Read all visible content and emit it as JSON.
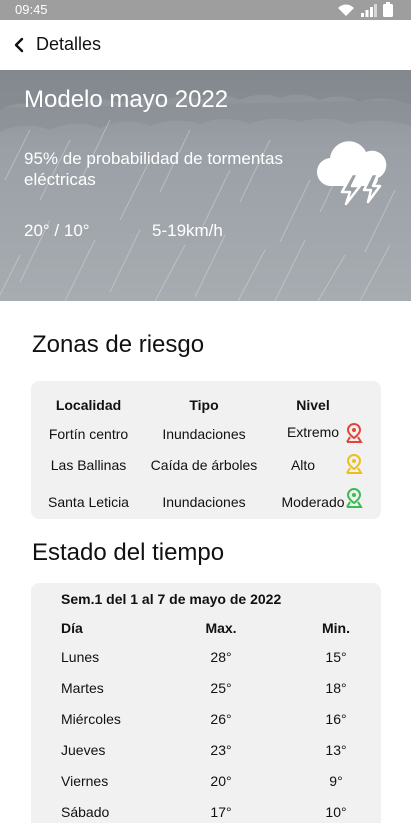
{
  "status_bar": {
    "time": "09:45"
  },
  "app_bar": {
    "title": "Detalles"
  },
  "hero": {
    "title": "Modelo mayo 2022",
    "description": "95% de probabilidad de tormentas eléctricas",
    "temperature": "20° / 10°",
    "wind": "5-19km/h",
    "icon": "storm-cloud-icon"
  },
  "risk": {
    "section_title": "Zonas de riesgo",
    "headers": {
      "location": "Localidad",
      "type": "Tipo",
      "level": "Nivel"
    },
    "rows": [
      {
        "location": "Fortín centro",
        "type": "Inundaciones",
        "level": "Extremo",
        "pin_color": "#e2463a"
      },
      {
        "location": "Las Ballinas",
        "type": "Caída de árboles",
        "level": "Alto",
        "pin_color": "#e8c020"
      },
      {
        "location": "Santa Leticia",
        "type": "Inundaciones",
        "level": "Moderado",
        "pin_color": "#3cba54"
      }
    ]
  },
  "weather": {
    "section_title": "Estado del tiempo",
    "week_title": "Sem.1 del 1 al 7 de mayo de 2022",
    "headers": {
      "day": "Día",
      "max": "Max.",
      "min": "Min."
    },
    "rows": [
      {
        "day": "Lunes",
        "max": "28°",
        "min": "15°"
      },
      {
        "day": "Martes",
        "max": "25°",
        "min": "18°"
      },
      {
        "day": "Miércoles",
        "max": "26°",
        "min": "16°"
      },
      {
        "day": "Jueves",
        "max": "23°",
        "min": "13°"
      },
      {
        "day": "Viernes",
        "max": "20°",
        "min": "9°"
      },
      {
        "day": "Sábado",
        "max": "17°",
        "min": "10°"
      }
    ]
  }
}
